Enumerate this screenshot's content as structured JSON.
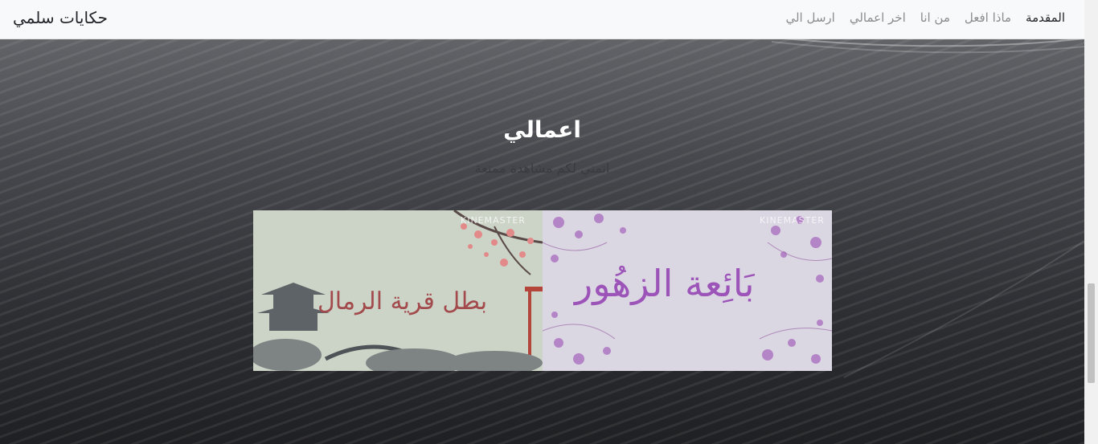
{
  "navbar": {
    "brand": "حكايات سلمي",
    "links": [
      {
        "label": "المقدمة",
        "active": true
      },
      {
        "label": "ماذا افعل",
        "active": false
      },
      {
        "label": "من انا",
        "active": false
      },
      {
        "label": "اخر اعمالي",
        "active": false
      },
      {
        "label": "ارسل الي",
        "active": false
      }
    ]
  },
  "section": {
    "title": "اعمالي",
    "subtitle": "اتمني لكم مشاهدة ممتعة"
  },
  "portfolio": [
    {
      "title": "بطل قرية الرمال",
      "watermark": "KINEMASTER"
    },
    {
      "title": "بَائِعة الزهُور",
      "watermark": "KINEMASTER"
    }
  ],
  "colors": {
    "navbar_bg": "#f8f9fa",
    "card1_title": "#a24a4c",
    "card2_title": "#9c54b8"
  }
}
